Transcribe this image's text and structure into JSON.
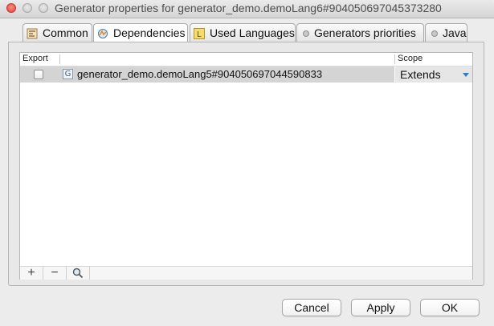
{
  "window": {
    "title": "Generator properties for generator_demo.demoLang6#904050697045373280"
  },
  "tabs": [
    {
      "label": "Common",
      "icon": "common-settings-icon",
      "active": false
    },
    {
      "label": "Dependencies",
      "icon": "dependencies-icon",
      "active": true
    },
    {
      "label": "Used Languages",
      "icon": "language-L-icon",
      "active": false
    },
    {
      "label": "Generators priorities",
      "icon": "bullet-icon",
      "active": false
    },
    {
      "label": "Java",
      "icon": "bullet-icon",
      "active": false
    }
  ],
  "table": {
    "columns": {
      "export": "Export",
      "name": "",
      "scope": "Scope"
    },
    "rows": [
      {
        "export_checked": false,
        "icon": "G",
        "name": "generator_demo.demoLang5#904050697044590833",
        "scope": "Extends",
        "selected": true
      }
    ]
  },
  "toolbar": {
    "add": "+",
    "remove": "−",
    "find": "search-icon"
  },
  "buttons": {
    "cancel": "Cancel",
    "apply": "Apply",
    "ok": "OK"
  },
  "colors": {
    "accent": "#2a7fd4",
    "selected_row": "#d4d4d4",
    "close_light": "#e0443e"
  }
}
